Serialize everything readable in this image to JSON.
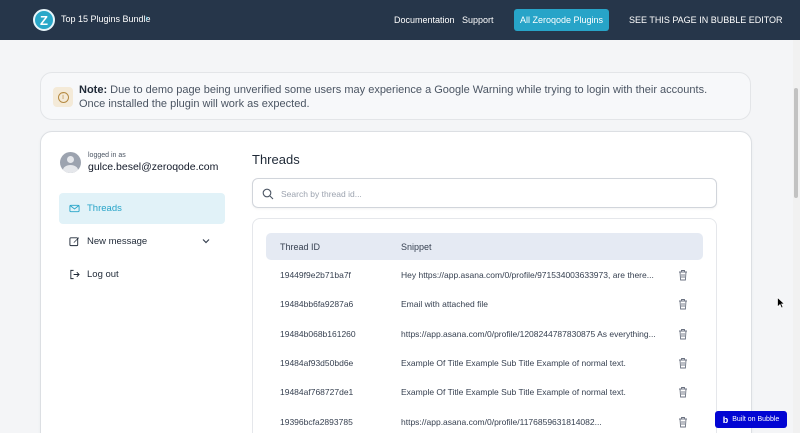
{
  "topbar": {
    "logo_letter": "Z",
    "bundle_title": "Top 15 Plugins Bundle",
    "chevron": "›",
    "links": {
      "documentation": "Documentation",
      "support": "Support"
    },
    "cta_button": "All Zeroqode Plugins",
    "editor_link": "SEE THIS PAGE IN BUBBLE EDITOR"
  },
  "note": {
    "icon": "info-icon",
    "prefix": "Note:",
    "line1": " Due to demo page being unverified some users may experience a Google Warning while trying to login with their accounts.",
    "line2": "Once installed the plugin will work as expected."
  },
  "user": {
    "logged_label": "logged in as",
    "email": "gulce.besel@zeroqode.com"
  },
  "sidebar": {
    "items": [
      {
        "label": "Threads",
        "icon": "mail-icon",
        "active": true
      },
      {
        "label": "New message",
        "icon": "edit-icon",
        "has_chevron": true
      },
      {
        "label": "Log out",
        "icon": "logout-icon"
      }
    ]
  },
  "threads": {
    "title": "Threads",
    "search_placeholder": "Search by thread id...",
    "columns": [
      "Thread ID",
      "Snippet"
    ],
    "rows": [
      {
        "id": "19449f9e2b71ba7f",
        "snippet": "Hey https://app.asana.com/0/profile/971534003633973, are there..."
      },
      {
        "id": "19484bb6fa9287a6",
        "snippet": "Email with attached file"
      },
      {
        "id": "19484b068b161260",
        "snippet": "https://app.asana.com/0/profile/1208244787830875 As everything..."
      },
      {
        "id": "19484af93d50bd6e",
        "snippet": "Example Of Title Example Sub Title Example of normal text."
      },
      {
        "id": "19484af768727de1",
        "snippet": "Example Of Title Example Sub Title Example of normal text."
      },
      {
        "id": "19396bcfa2893785",
        "snippet": "https://app.asana.com/0/profile/1176859631814082..."
      }
    ]
  },
  "footer": {
    "bubble_logo": "b",
    "bubble_label": "Built on Bubble"
  },
  "colors": {
    "topbar": "#26364a",
    "accent": "#27a4c8",
    "bubble": "#0205d3"
  }
}
